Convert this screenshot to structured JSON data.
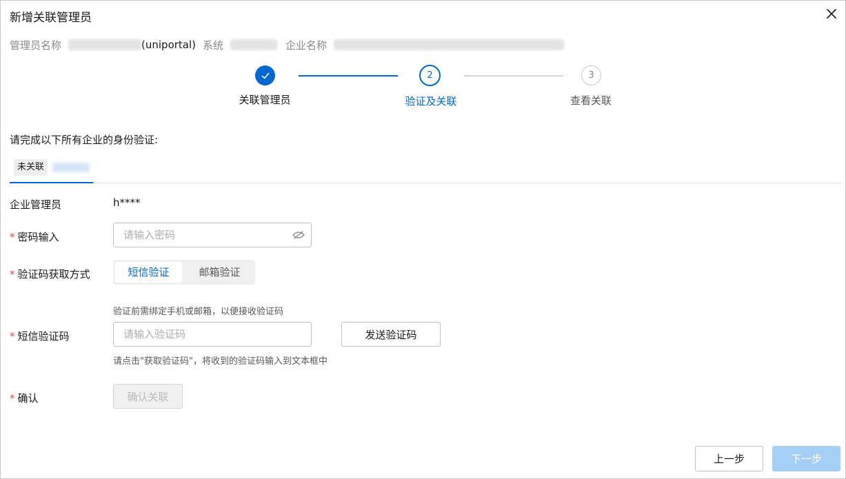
{
  "dialog": {
    "title": "新增关联管理员"
  },
  "info": {
    "admin_name_label": "管理员名称",
    "admin_name_suffix": "(uniportal)",
    "system_label": "系统",
    "company_label": "企业名称"
  },
  "steps": [
    {
      "number": "1",
      "label": "关联管理员",
      "status": "done"
    },
    {
      "number": "2",
      "label": "验证及关联",
      "status": "current"
    },
    {
      "number": "3",
      "label": "查看关联",
      "status": "pending"
    }
  ],
  "instruction": "请完成以下所有企业的身份验证:",
  "tab": {
    "badge": "未关联"
  },
  "form": {
    "enterprise_admin_label": "企业管理员",
    "enterprise_admin_value": "h****",
    "password_label": "密码输入",
    "password_placeholder": "请输入密码",
    "method_label": "验证码获取方式",
    "method_options": [
      "短信验证",
      "邮箱验证"
    ],
    "method_selected": "短信验证",
    "method_hint": "验证前需绑定手机或邮箱，以便接收验证码",
    "sms_label": "短信验证码",
    "sms_placeholder": "请输入验证码",
    "send_code_label": "发送验证码",
    "sms_hint": "请点击\"获取验证码\"，将收到的验证码输入到文本框中",
    "confirm_label": "确认",
    "confirm_button": "确认关联"
  },
  "footer": {
    "prev_label": "上一步",
    "next_label": "下一步"
  },
  "colors": {
    "primary": "#0067d1",
    "primary_disabled": "#a6cff5",
    "required": "#e54545",
    "line_done": "#0067d1",
    "line_pending": "#d5d5d5"
  }
}
